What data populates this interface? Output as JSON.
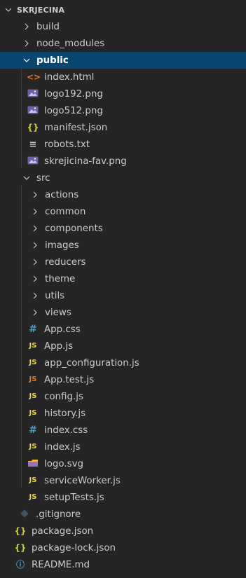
{
  "explorer": {
    "root": {
      "label": "SKRJECINA",
      "chevron": "chevron-down"
    },
    "items": [
      {
        "label": "build",
        "kind": "folder",
        "state": "collapsed"
      },
      {
        "label": "node_modules",
        "kind": "folder",
        "state": "collapsed"
      },
      {
        "label": "public",
        "kind": "folder",
        "state": "expanded",
        "selected": true
      },
      {
        "label": "index.html",
        "kind": "html-file",
        "icon_glyph": "<>"
      },
      {
        "label": "logo192.png",
        "kind": "image-file"
      },
      {
        "label": "logo512.png",
        "kind": "image-file"
      },
      {
        "label": "manifest.json",
        "kind": "json-file",
        "icon_glyph": "{}"
      },
      {
        "label": "robots.txt",
        "kind": "text-file",
        "icon_glyph": "≡"
      },
      {
        "label": "skrejicina-fav.png",
        "kind": "image-file"
      },
      {
        "label": "src",
        "kind": "folder",
        "state": "expanded"
      },
      {
        "label": "actions",
        "kind": "folder",
        "state": "collapsed"
      },
      {
        "label": "common",
        "kind": "folder",
        "state": "collapsed"
      },
      {
        "label": "components",
        "kind": "folder",
        "state": "collapsed"
      },
      {
        "label": "images",
        "kind": "folder",
        "state": "collapsed"
      },
      {
        "label": "reducers",
        "kind": "folder",
        "state": "collapsed"
      },
      {
        "label": "theme",
        "kind": "folder",
        "state": "collapsed"
      },
      {
        "label": "utils",
        "kind": "folder",
        "state": "collapsed"
      },
      {
        "label": "views",
        "kind": "folder",
        "state": "collapsed"
      },
      {
        "label": "App.css",
        "kind": "css-file",
        "icon_glyph": "#"
      },
      {
        "label": "App.js",
        "kind": "js-file",
        "icon_glyph": "JS"
      },
      {
        "label": "app_configuration.js",
        "kind": "js-file",
        "icon_glyph": "JS"
      },
      {
        "label": "App.test.js",
        "kind": "js-test-file",
        "icon_glyph": "JS"
      },
      {
        "label": "config.js",
        "kind": "js-file",
        "icon_glyph": "JS"
      },
      {
        "label": "history.js",
        "kind": "js-file",
        "icon_glyph": "JS"
      },
      {
        "label": "index.css",
        "kind": "css-file",
        "icon_glyph": "#"
      },
      {
        "label": "index.js",
        "kind": "js-file",
        "icon_glyph": "JS"
      },
      {
        "label": "logo.svg",
        "kind": "svg-file"
      },
      {
        "label": "serviceWorker.js",
        "kind": "js-file",
        "icon_glyph": "JS"
      },
      {
        "label": "setupTests.js",
        "kind": "js-file",
        "icon_glyph": "JS"
      },
      {
        "label": ".gitignore",
        "kind": "git-file"
      },
      {
        "label": "package.json",
        "kind": "json-file",
        "icon_glyph": "{}"
      },
      {
        "label": "package-lock.json",
        "kind": "json-file",
        "icon_glyph": "{}"
      },
      {
        "label": "README.md",
        "kind": "info-file",
        "icon_glyph": "ⓘ"
      }
    ]
  },
  "colors": {
    "background": "#252526",
    "selection": "#094771",
    "text": "#cccccc",
    "js_icon": "#e8d44d",
    "js_test_icon": "#e37933",
    "css_icon": "#519aba",
    "json_icon": "#cbcb41",
    "html_icon": "#e37933",
    "image_icon": "#a074c4",
    "svg_icon": "#ffb13b"
  }
}
